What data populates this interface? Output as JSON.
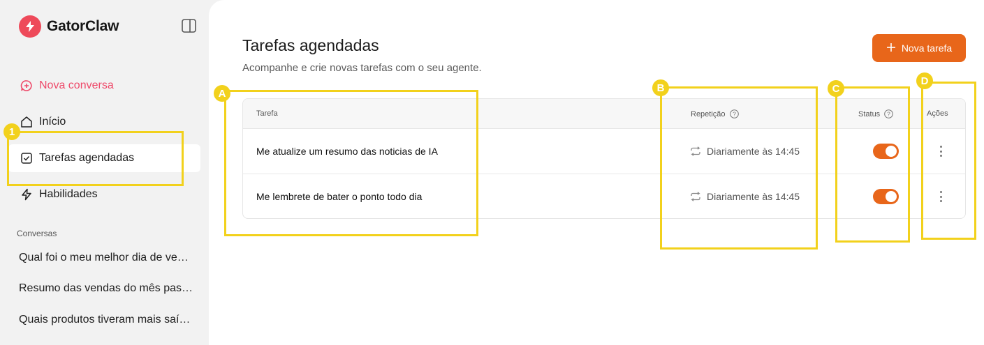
{
  "app": {
    "name": "GatorClaw"
  },
  "sidebar": {
    "new_chat": "Nova conversa",
    "items": [
      {
        "label": "Início"
      },
      {
        "label": "Tarefas agendadas"
      },
      {
        "label": "Habilidades"
      }
    ],
    "section_label": "Conversas",
    "conversations": [
      "Qual foi o meu melhor dia de vendas?",
      "Resumo das vendas do mês passado",
      "Quais produtos tiveram mais saída?"
    ]
  },
  "main": {
    "title": "Tarefas agendadas",
    "subtitle": "Acompanhe e crie novas tarefas com o seu agente.",
    "new_task_button": "Nova tarefa",
    "table": {
      "headers": {
        "task": "Tarefa",
        "repeat": "Repetição",
        "status": "Status",
        "actions": "Ações"
      },
      "rows": [
        {
          "task": "Me atualize um resumo das noticias de IA",
          "repeat": "Diariamente às 14:45",
          "enabled": true
        },
        {
          "task": "Me lembrete de bater o ponto todo dia",
          "repeat": "Diariamente às 14:45",
          "enabled": true
        }
      ]
    }
  },
  "annotations": {
    "badges": [
      "1",
      "A",
      "B",
      "C",
      "D"
    ]
  },
  "colors": {
    "accent": "#e8661a",
    "brand": "#ee4a5a",
    "annotation": "#f2d11c"
  }
}
